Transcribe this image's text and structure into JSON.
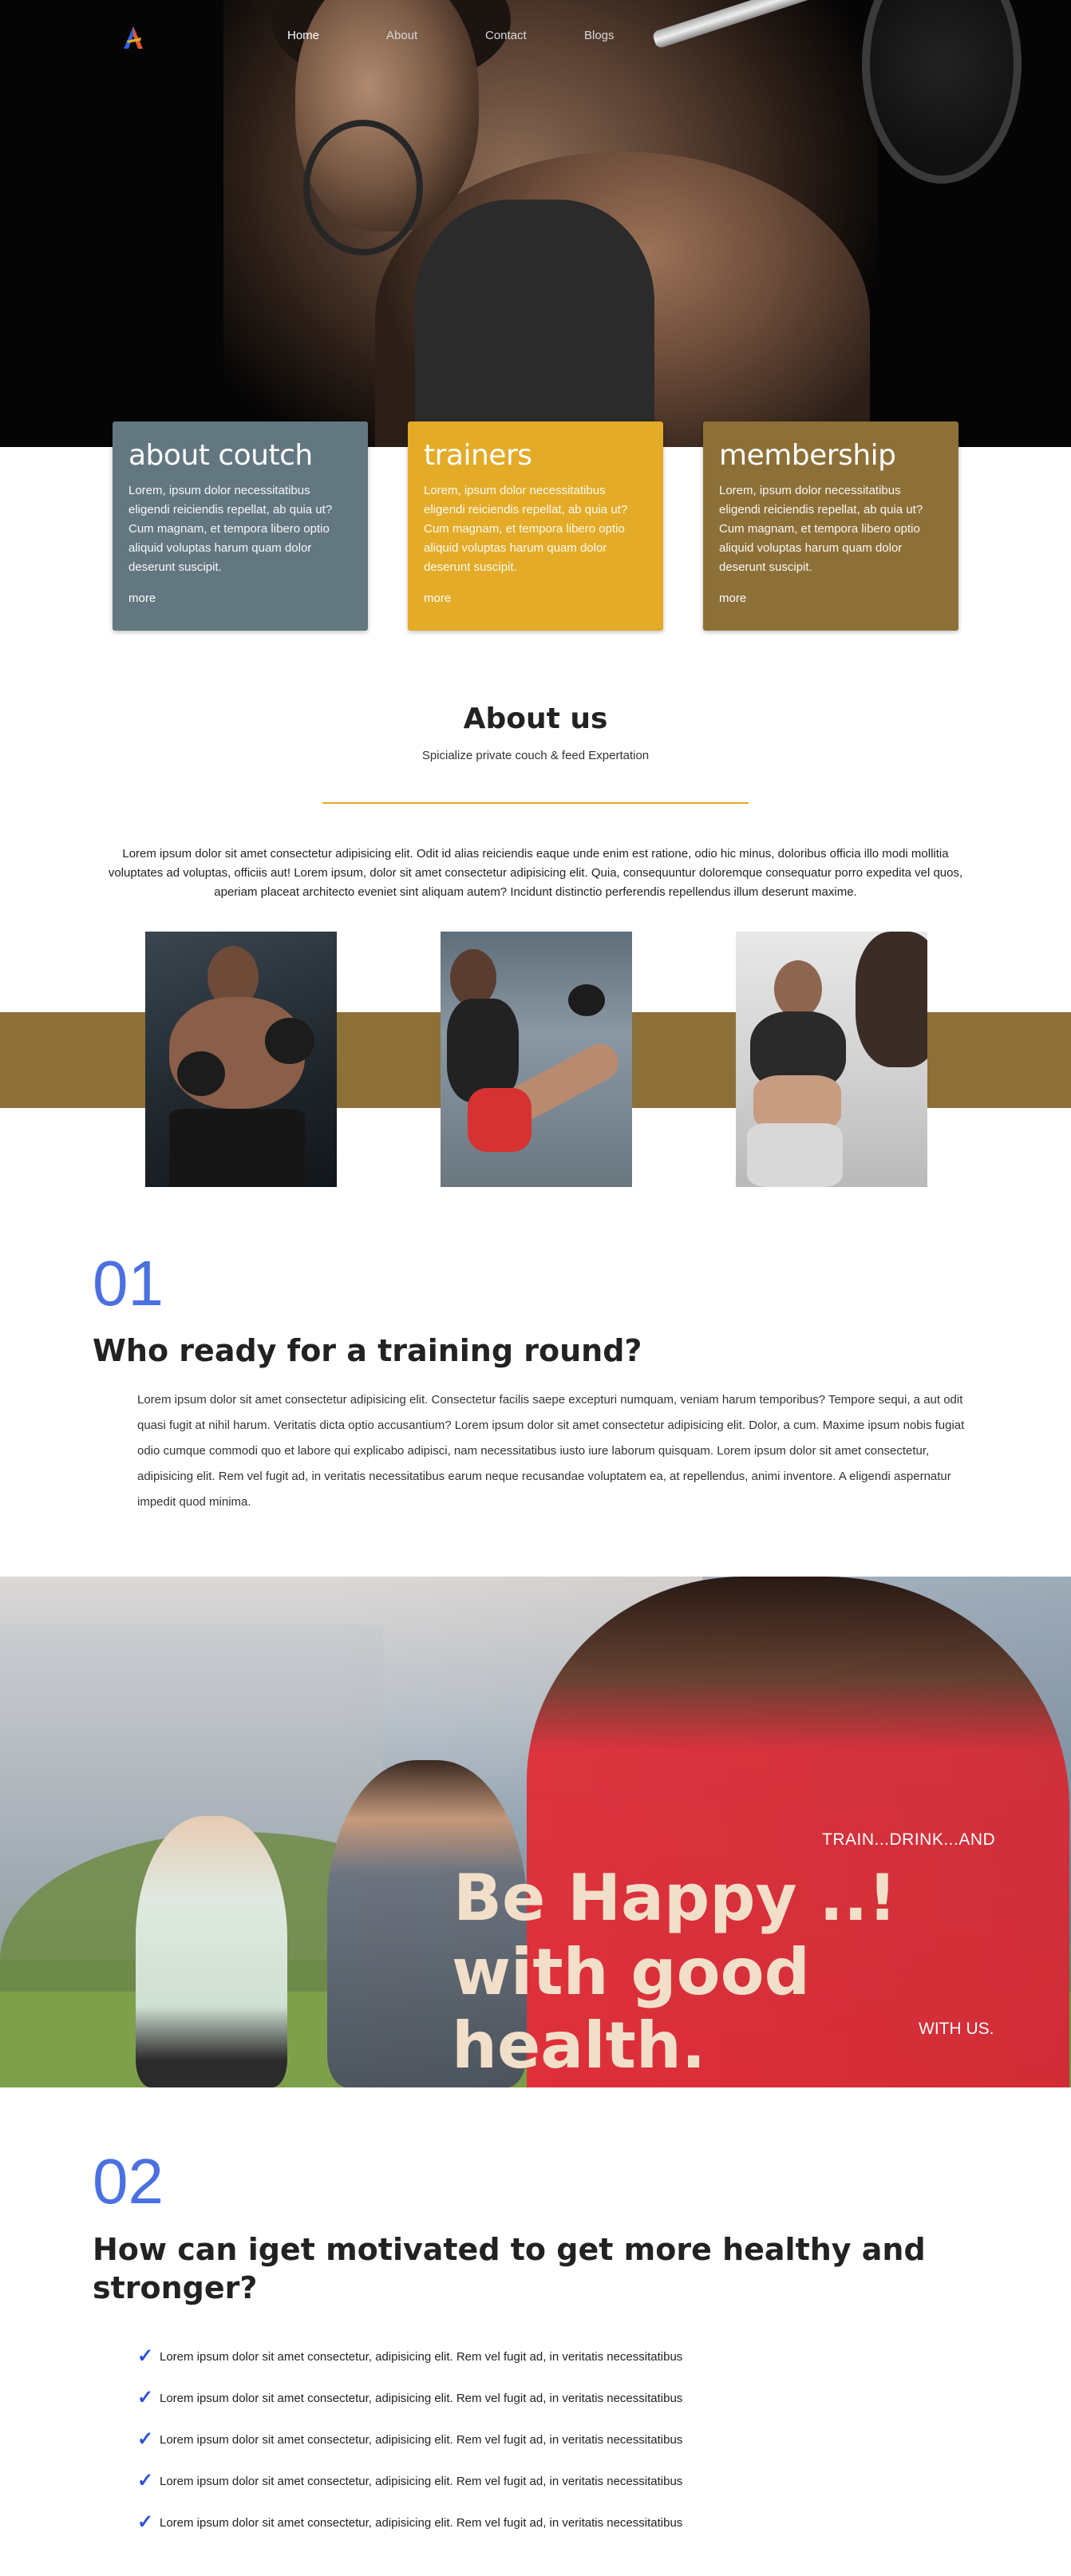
{
  "nav": {
    "items": [
      {
        "label": "Home",
        "active": true
      },
      {
        "label": "About",
        "active": false
      },
      {
        "label": "Contact",
        "active": false
      },
      {
        "label": "Blogs",
        "active": false
      }
    ]
  },
  "cards": [
    {
      "title": "about coutch",
      "text": "Lorem, ipsum dolor necessitatibus eligendi reiciendis repellat, ab quia ut? Cum magnam, et tempora libero optio aliquid voluptas harum quam dolor deserunt suscipit.",
      "link": "more",
      "color": "#637781"
    },
    {
      "title": "trainers",
      "text": "Lorem, ipsum dolor necessitatibus eligendi reiciendis repellat, ab quia ut? Cum magnam, et tempora libero optio aliquid voluptas harum quam dolor deserunt suscipit.",
      "link": "more",
      "color": "#e3ab27"
    },
    {
      "title": "membership",
      "text": "Lorem, ipsum dolor necessitatibus eligendi reiciendis repellat, ab quia ut? Cum magnam, et tempora libero optio aliquid voluptas harum quam dolor deserunt suscipit.",
      "link": "more",
      "color": "#8d7038"
    }
  ],
  "about": {
    "title": "About us",
    "subtitle": "Spicialize private couch & feed Expertation",
    "text": "Lorem ipsum dolor sit amet consectetur adipisicing elit. Odit id alias reiciendis eaque unde enim est ratione, odio hic minus, doloribus officia illo modi mollitia voluptates ad voluptas, officiis aut! Lorem ipsum, dolor sit amet consectetur adipisicing elit. Quia, consequuntur doloremque consequatur porro expedita vel quos, aperiam placeat architecto eveniet sint aliquam autem? Incidunt distinctio perferendis repellendus illum deserunt maxime.",
    "accent": "#e3ab27",
    "band_color": "#8d7038"
  },
  "section1": {
    "number": "01",
    "title": "Who ready for a training round?",
    "text": "Lorem ipsum dolor sit amet consectetur adipisicing elit. Consectetur facilis saepe excepturi numquam, veniam harum temporibus? Tempore sequi, a aut odit quasi fugit at nihil harum. Veritatis dicta optio accusantium? Lorem ipsum dolor sit amet consectetur adipisicing elit. Dolor, a cum. Maxime ipsum nobis fugiat odio cumque commodi quo et labore qui explicabo adipisci, nam necessitatibus iusto iure laborum quisquam. Lorem ipsum dolor sit amet consectetur, adipisicing elit. Rem vel fugit ad, in veritatis necessitatibus earum neque recusandae voluptatem ea, at repellendus, animi inventore. A eligendi aspernatur impedit quod minima."
  },
  "banner": {
    "top": "TRAIN...DRINK...AND",
    "line1": "Be Happy ..!",
    "line2": "with good health.",
    "bottom": "WITH US."
  },
  "section2": {
    "number": "02",
    "title": "How can iget motivated to get more healthy and stronger?",
    "items": [
      "Lorem ipsum dolor sit amet consectetur, adipisicing elit. Rem vel fugit ad, in veritatis necessitatibus",
      "Lorem ipsum dolor sit amet consectetur, adipisicing elit. Rem vel fugit ad, in veritatis necessitatibus",
      "Lorem ipsum dolor sit amet consectetur, adipisicing elit. Rem vel fugit ad, in veritatis necessitatibus",
      "Lorem ipsum dolor sit amet consectetur, adipisicing elit. Rem vel fugit ad, in veritatis necessitatibus",
      "Lorem ipsum dolor sit amet consectetur, adipisicing elit. Rem vel fugit ad, in veritatis necessitatibus"
    ],
    "check_icon": "checkmark-icon",
    "number_color": "#4b70e2"
  }
}
